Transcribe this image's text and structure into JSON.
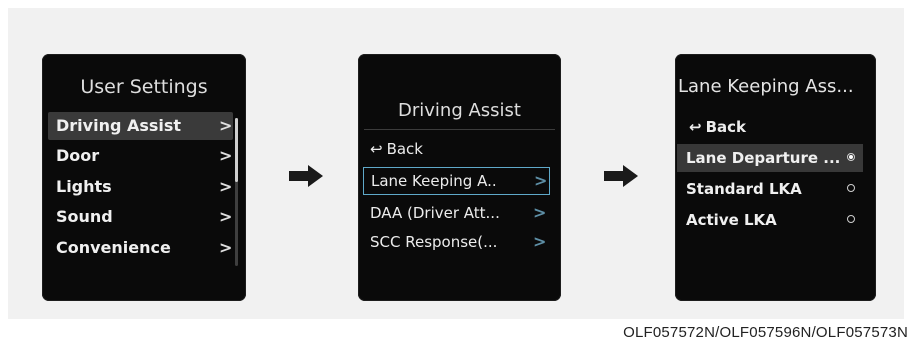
{
  "screens": [
    {
      "title": "User Settings",
      "items": [
        {
          "label": "Driving Assist",
          "chevron": ">",
          "selected": true
        },
        {
          "label": "Door",
          "chevron": ">"
        },
        {
          "label": "Lights",
          "chevron": ">"
        },
        {
          "label": "Sound",
          "chevron": ">"
        },
        {
          "label": "Convenience",
          "chevron": ">"
        }
      ]
    },
    {
      "title": "Driving Assist",
      "back": "Back",
      "back_icon": "↩",
      "items": [
        {
          "label": "Lane Keeping A..",
          "chevron": ">",
          "selected": true
        },
        {
          "label": "DAA (Driver Att...",
          "chevron": ">"
        },
        {
          "label": "SCC Response(...",
          "chevron": ">"
        }
      ]
    },
    {
      "title": "Lane Keeping Ass...",
      "back": "Back",
      "back_icon": "↩",
      "options": [
        {
          "label": "Lane Departure ...",
          "selected": true
        },
        {
          "label": "Standard LKA",
          "selected": false
        },
        {
          "label": "Active LKA",
          "selected": false
        }
      ]
    }
  ],
  "caption": "OLF057572N/OLF057596N/OLF057573N",
  "colors": {
    "screen_bg": "#0a0a0a",
    "highlight_border": "#5fa9c9",
    "chevron_blue": "#5e8fa6",
    "arrow": "#1a1a1a"
  }
}
